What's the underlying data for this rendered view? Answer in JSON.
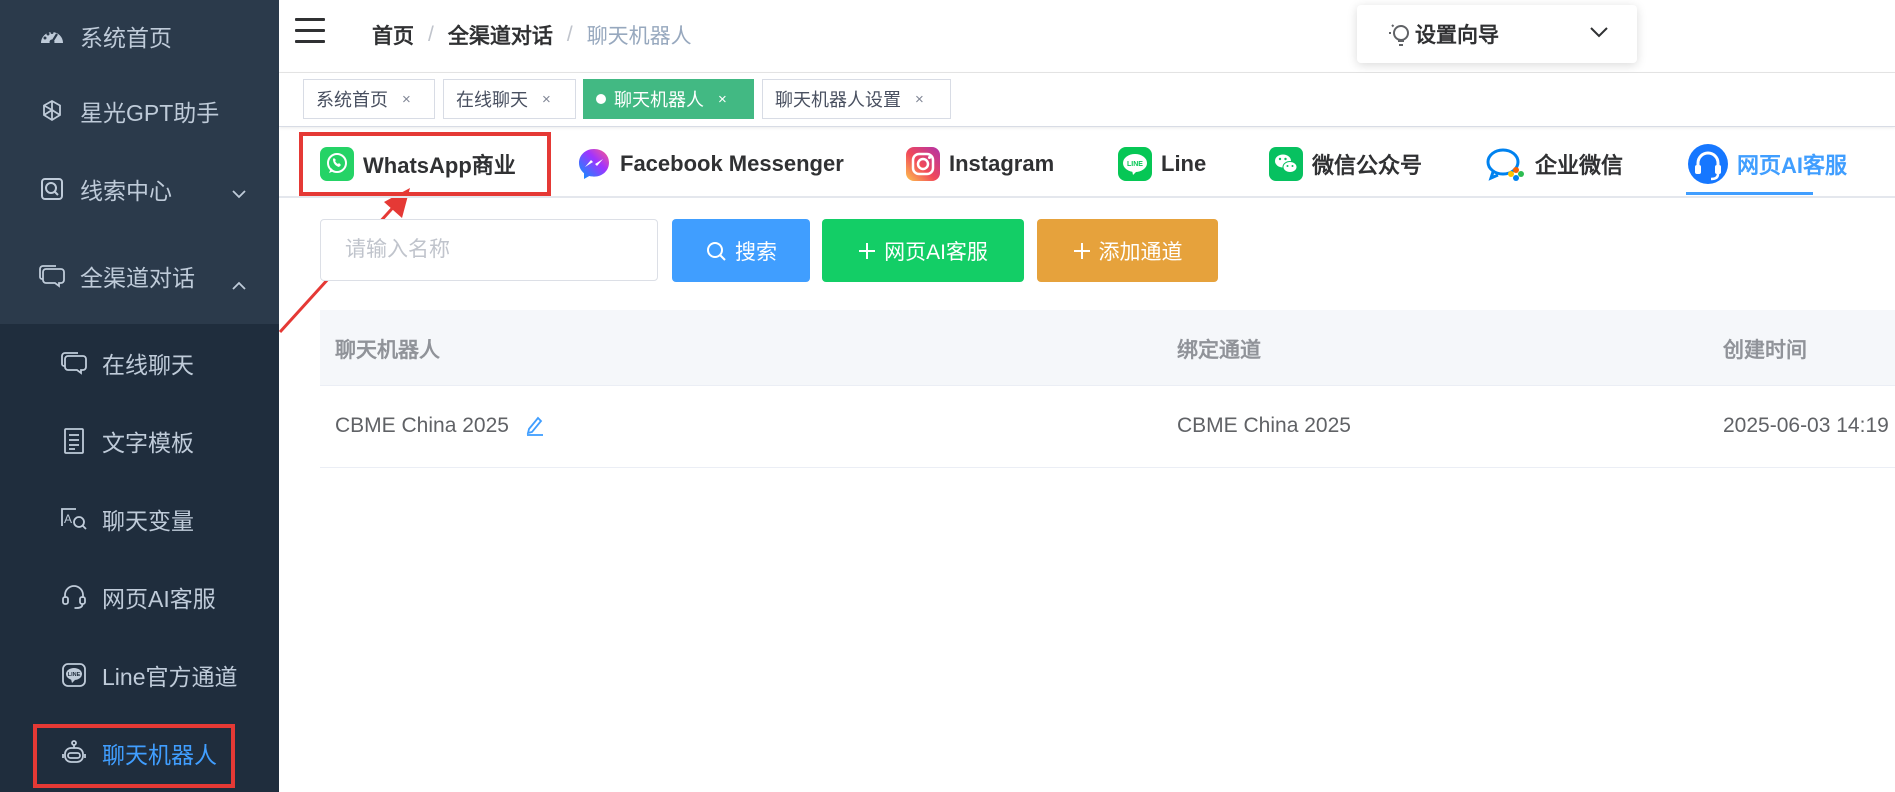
{
  "sidebar": {
    "items": [
      {
        "label": "系统首页",
        "icon": "dashboard-icon"
      },
      {
        "label": "星光GPT助手",
        "icon": "openai-icon"
      },
      {
        "label": "线索中心",
        "icon": "search-box-icon"
      },
      {
        "label": "全渠道对话",
        "icon": "chat-bubbles-icon"
      }
    ],
    "subitems": [
      {
        "label": "在线聊天",
        "icon": "chat-bubbles-icon"
      },
      {
        "label": "文字模板",
        "icon": "document-icon"
      },
      {
        "label": "聊天变量",
        "icon": "variable-search-icon"
      },
      {
        "label": "网页AI客服",
        "icon": "headset-icon"
      },
      {
        "label": "Line官方通道",
        "icon": "line-icon"
      },
      {
        "label": "聊天机器人",
        "icon": "robot-icon"
      }
    ]
  },
  "header": {
    "breadcrumb": [
      "首页",
      "全渠道对话",
      "聊天机器人"
    ],
    "separator": "/",
    "wizard_label": "设置向导"
  },
  "tags": [
    {
      "label": "系统首页",
      "close": "×"
    },
    {
      "label": "在线聊天",
      "close": "×"
    },
    {
      "label": "聊天机器人",
      "close": "×",
      "active": true
    },
    {
      "label": "聊天机器人设置",
      "close": "×"
    }
  ],
  "channel_tabs": [
    {
      "label": "WhatsApp商业",
      "icon": "whatsapp-icon"
    },
    {
      "label": "Facebook Messenger",
      "icon": "messenger-icon"
    },
    {
      "label": "Instagram",
      "icon": "instagram-icon"
    },
    {
      "label": "Line",
      "icon": "line-icon"
    },
    {
      "label": "微信公众号",
      "icon": "wechat-icon"
    },
    {
      "label": "企业微信",
      "icon": "wecom-icon"
    },
    {
      "label": "网页AI客服",
      "icon": "headset-icon",
      "active": true
    }
  ],
  "search": {
    "placeholder": "请输入名称",
    "search_label": "搜索",
    "add_web_ai_label": "网页AI客服",
    "add_channel_label": "添加通道"
  },
  "table": {
    "columns": [
      "聊天机器人",
      "绑定通道",
      "创建时间"
    ],
    "rows": [
      {
        "name": "CBME China 2025",
        "channel": "CBME China 2025",
        "created": "2025-06-03 14:19"
      }
    ]
  },
  "colors": {
    "sidebar_bg": "#1f2d3d",
    "accent": "#409eff",
    "active_tag": "#42b983",
    "green_button": "#13ce66",
    "orange_button": "#e6a23c",
    "annotation_red": "#e53935"
  }
}
